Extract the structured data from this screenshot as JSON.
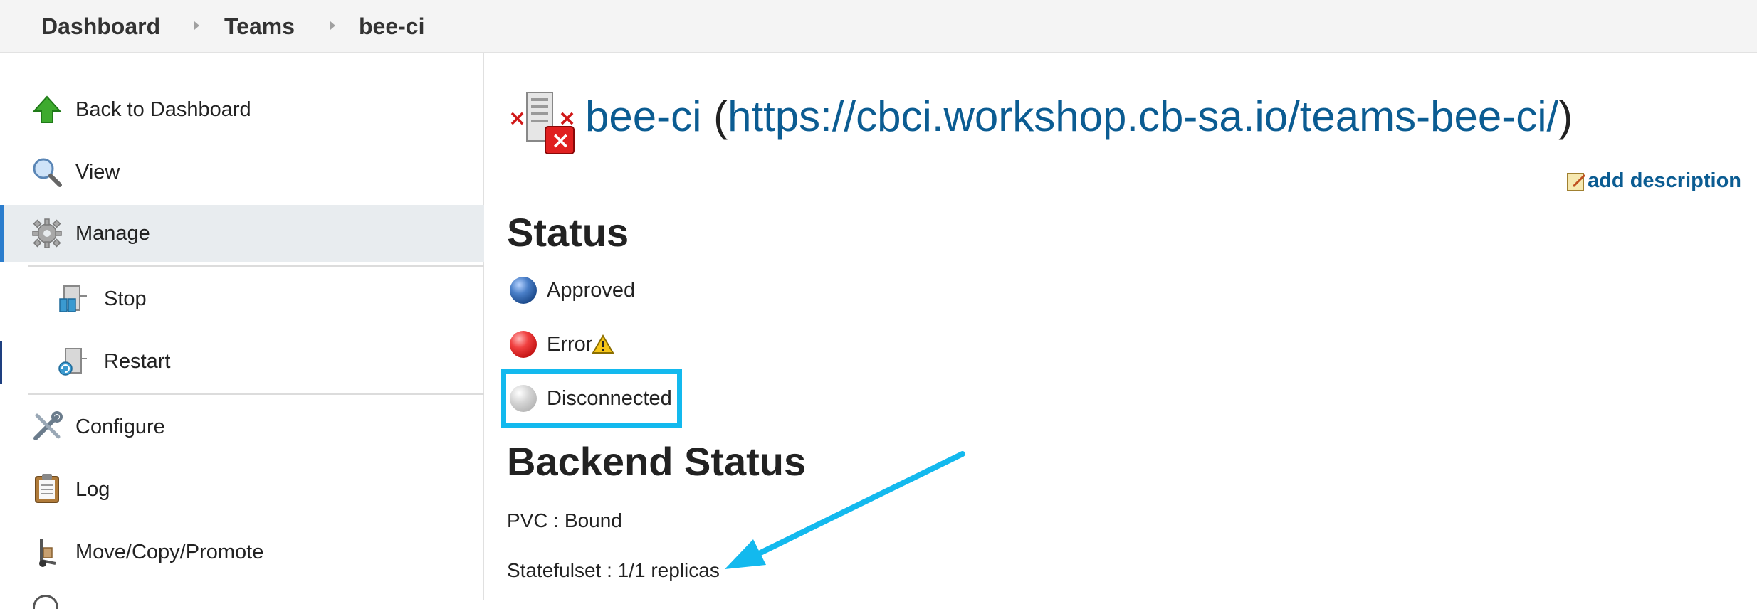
{
  "breadcrumb": {
    "items": [
      "Dashboard",
      "Teams",
      "bee-ci"
    ]
  },
  "sidebar": {
    "items": [
      {
        "label": "Back to Dashboard",
        "icon": "up-arrow-icon"
      },
      {
        "label": "View",
        "icon": "magnifier-icon"
      },
      {
        "label": "Manage",
        "icon": "gear-icon",
        "active": true
      },
      {
        "label": "Stop",
        "icon": "server-stop-icon"
      },
      {
        "label": "Restart",
        "icon": "server-restart-icon"
      },
      {
        "label": "Configure",
        "icon": "wrench-screwdriver-icon"
      },
      {
        "label": "Log",
        "icon": "clipboard-icon"
      },
      {
        "label": "Move/Copy/Promote",
        "icon": "hand-truck-icon"
      }
    ]
  },
  "main": {
    "title_name": "bee-ci",
    "title_open": " (",
    "title_url": "https://cbci.workshop.cb-sa.io/teams-bee-ci/",
    "title_close": ")",
    "add_description": "add description",
    "status_heading": "Status",
    "statuses": [
      {
        "label": "Approved",
        "color": "blue"
      },
      {
        "label": "Error",
        "color": "red",
        "warning": true
      },
      {
        "label": "Disconnected",
        "color": "grey",
        "highlighted": true
      }
    ],
    "backend_heading": "Backend Status",
    "pvc": "PVC : Bound",
    "statefulset": "Statefulset : 1/1 replicas"
  },
  "colors": {
    "link": "#0b5c92",
    "highlight": "#13b9ee",
    "active_sidebar": "#e8ecef",
    "active_accent": "#2b7dcd"
  }
}
